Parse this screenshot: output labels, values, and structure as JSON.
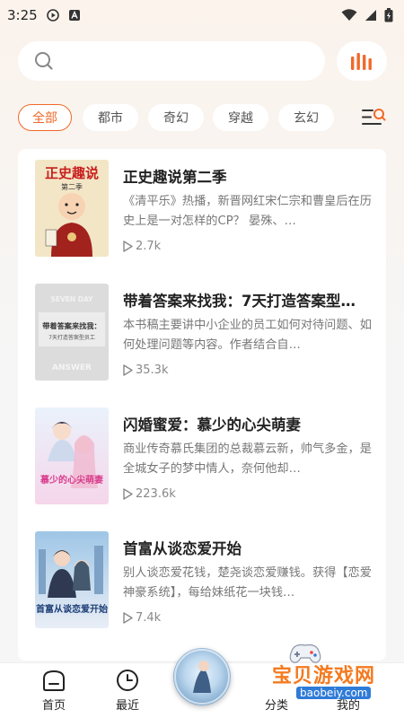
{
  "status_bar": {
    "time": "3:25"
  },
  "search": {
    "placeholder": ""
  },
  "categories": [
    {
      "label": "全部",
      "active": true
    },
    {
      "label": "都市",
      "active": false
    },
    {
      "label": "奇幻",
      "active": false
    },
    {
      "label": "穿越",
      "active": false
    },
    {
      "label": "玄幻",
      "active": false
    }
  ],
  "books": [
    {
      "title": "正史趣说第二季",
      "desc": "《清平乐》热播，新晋网红宋仁宗和曹皇后在历史上是一对怎样的CP？ 晏殊、…",
      "plays": "2.7k",
      "cover_text": "正史趣说",
      "cover_sub": "第二季"
    },
    {
      "title": "带着答案来找我：7天打造答案型…",
      "desc": "本书稿主要讲中小企业的员工如何对待问题、如何处理问题等内容。作者结合自…",
      "plays": "35.3k",
      "cover_text": "带着答案来找我：",
      "cover_sub": "7天打造答案型员工",
      "cover_top": "SEVEN DAY",
      "cover_bottom": "ANSWER"
    },
    {
      "title": "闪婚蜜爱：慕少的心尖萌妻",
      "desc": "商业传奇慕氏集团的总裁慕云新，帅气多金，是全城女子的梦中情人，奈何他却…",
      "plays": "223.6k",
      "cover_text": "慕少的心尖萌妻"
    },
    {
      "title": "首富从谈恋爱开始",
      "desc": "别人谈恋爱花钱，楚尧谈恋爱赚钱。获得【恋爱神豪系统】，每给妹纸花一块钱…",
      "plays": "7.4k",
      "cover_text": "首富从谈恋爱开始"
    }
  ],
  "tabs": [
    {
      "label": "首页"
    },
    {
      "label": "最近"
    },
    {
      "label": "分类"
    },
    {
      "label": "我的"
    }
  ],
  "watermark": {
    "text": "宝贝游戏网",
    "url": "baobeiy.com"
  },
  "colors": {
    "accent": "#f06a2a",
    "text": "#222222",
    "muted": "#777777"
  }
}
